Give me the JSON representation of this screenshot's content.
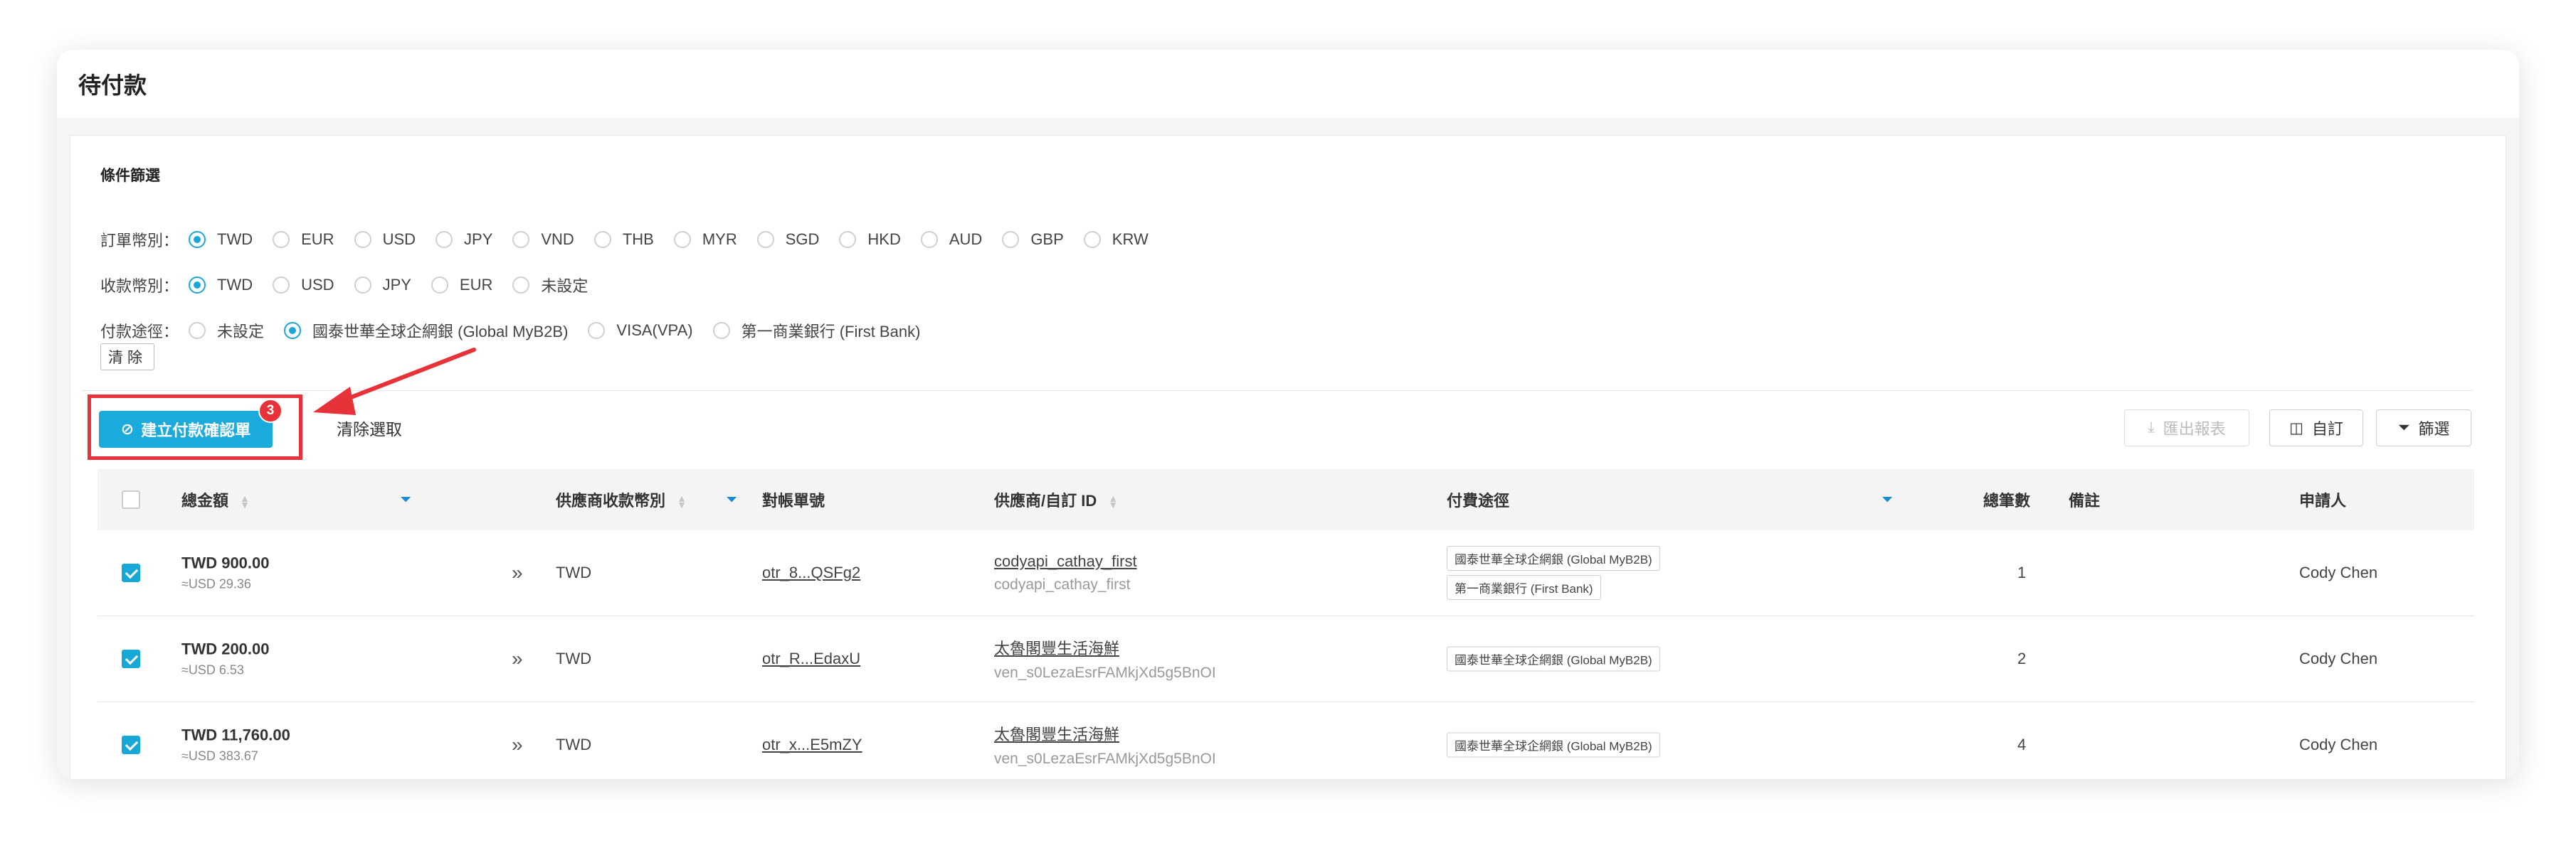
{
  "page": {
    "title": "待付款"
  },
  "filters": {
    "section_title": "條件篩選",
    "order_currency": {
      "label": "訂單幣別：",
      "options": [
        "TWD",
        "EUR",
        "USD",
        "JPY",
        "VND",
        "THB",
        "MYR",
        "SGD",
        "HKD",
        "AUD",
        "GBP",
        "KRW"
      ],
      "selected": "TWD"
    },
    "receive_currency": {
      "label": "收款幣別：",
      "options": [
        "TWD",
        "USD",
        "JPY",
        "EUR",
        "未設定"
      ],
      "selected": "TWD"
    },
    "payment_route": {
      "label": "付款途徑：",
      "options": [
        "未設定",
        "國泰世華全球企網銀 (Global MyB2B)",
        "VISA(VPA)",
        "第一商業銀行 (First Bank)"
      ],
      "selected": "國泰世華全球企網銀 (Global MyB2B)"
    },
    "clear_label": "清除"
  },
  "toolbar": {
    "create_label": "建立付款確認單",
    "create_badge": "3",
    "deselect_label": "清除選取",
    "export_label": "匯出報表",
    "custom_label": "自訂",
    "filter_label": "篩選"
  },
  "table": {
    "headers": {
      "amount": "總金額",
      "vendor_currency": "供應商收款幣別",
      "statement_no": "對帳單號",
      "vendor_id": "供應商/自訂 ID",
      "payment_route": "付費途徑",
      "count": "總筆數",
      "note": "備註",
      "applicant": "申請人"
    },
    "rows": [
      {
        "amount": "TWD 900.00",
        "amount_sub": "≈USD 29.36",
        "currency": "TWD",
        "statement": "otr_8...QSFg2",
        "vendor": "codyapi_cathay_first",
        "vendor_sub": "codyapi_cathay_first",
        "routes": [
          "國泰世華全球企網銀 (Global MyB2B)",
          "第一商業銀行 (First Bank)"
        ],
        "count": "1",
        "note": "",
        "applicant": "Cody Chen",
        "checked": true
      },
      {
        "amount": "TWD 200.00",
        "amount_sub": "≈USD 6.53",
        "currency": "TWD",
        "statement": "otr_R...EdaxU",
        "vendor": "太魯閣豐生活海鮮",
        "vendor_sub": "ven_s0LezaEsrFAMkjXd5g5BnOI",
        "routes": [
          "國泰世華全球企網銀 (Global MyB2B)"
        ],
        "count": "2",
        "note": "",
        "applicant": "Cody Chen",
        "checked": true
      },
      {
        "amount": "TWD 11,760.00",
        "amount_sub": "≈USD 383.67",
        "currency": "TWD",
        "statement": "otr_x...E5mZY",
        "vendor": "太魯閣豐生活海鮮",
        "vendor_sub": "ven_s0LezaEsrFAMkjXd5g5BnOI",
        "routes": [
          "國泰世華全球企網銀 (Global MyB2B)"
        ],
        "count": "4",
        "note": "",
        "applicant": "Cody Chen",
        "checked": true
      }
    ]
  },
  "colors": {
    "accent": "#1aabdc",
    "highlight": "#e8323a"
  },
  "icons": {
    "create": "check-circle-icon",
    "export": "download-icon",
    "custom": "columns-icon",
    "filter": "funnel-icon",
    "expand": "double-chevron-right-icon"
  }
}
